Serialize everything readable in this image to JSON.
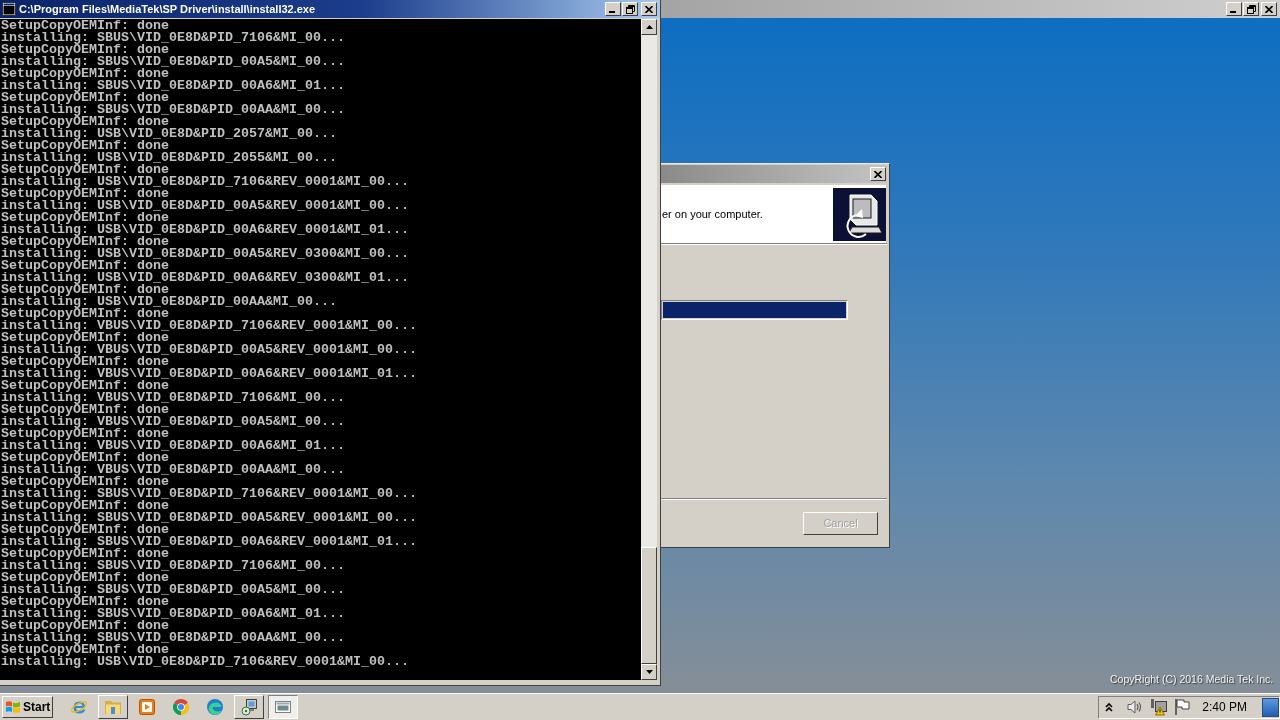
{
  "console_window": {
    "title": "C:\\Program Files\\MediaTek\\SP Driver\\install\\install32.exe",
    "lines": [
      "SetupCopyOEMInf: done",
      "installing: SBUS\\VID_0E8D&PID_7106&MI_00...",
      "SetupCopyOEMInf: done",
      "installing: SBUS\\VID_0E8D&PID_00A5&MI_00...",
      "SetupCopyOEMInf: done",
      "installing: SBUS\\VID_0E8D&PID_00A6&MI_01...",
      "SetupCopyOEMInf: done",
      "installing: SBUS\\VID_0E8D&PID_00AA&MI_00...",
      "SetupCopyOEMInf: done",
      "installing: USB\\VID_0E8D&PID_2057&MI_00...",
      "SetupCopyOEMInf: done",
      "installing: USB\\VID_0E8D&PID_2055&MI_00...",
      "SetupCopyOEMInf: done",
      "installing: USB\\VID_0E8D&PID_7106&REV_0001&MI_00...",
      "SetupCopyOEMInf: done",
      "installing: USB\\VID_0E8D&PID_00A5&REV_0001&MI_00...",
      "SetupCopyOEMInf: done",
      "installing: USB\\VID_0E8D&PID_00A6&REV_0001&MI_01...",
      "SetupCopyOEMInf: done",
      "installing: USB\\VID_0E8D&PID_00A5&REV_0300&MI_00...",
      "SetupCopyOEMInf: done",
      "installing: USB\\VID_0E8D&PID_00A6&REV_0300&MI_01...",
      "SetupCopyOEMInf: done",
      "installing: USB\\VID_0E8D&PID_00AA&MI_00...",
      "SetupCopyOEMInf: done",
      "installing: VBUS\\VID_0E8D&PID_7106&REV_0001&MI_00...",
      "SetupCopyOEMInf: done",
      "installing: VBUS\\VID_0E8D&PID_00A5&REV_0001&MI_00...",
      "SetupCopyOEMInf: done",
      "installing: VBUS\\VID_0E8D&PID_00A6&REV_0001&MI_01...",
      "SetupCopyOEMInf: done",
      "installing: VBUS\\VID_0E8D&PID_7106&MI_00...",
      "SetupCopyOEMInf: done",
      "installing: VBUS\\VID_0E8D&PID_00A5&MI_00...",
      "SetupCopyOEMInf: done",
      "installing: VBUS\\VID_0E8D&PID_00A6&MI_01...",
      "SetupCopyOEMInf: done",
      "installing: VBUS\\VID_0E8D&PID_00AA&MI_00...",
      "SetupCopyOEMInf: done",
      "installing: SBUS\\VID_0E8D&PID_7106&REV_0001&MI_00...",
      "SetupCopyOEMInf: done",
      "installing: SBUS\\VID_0E8D&PID_00A5&REV_0001&MI_00...",
      "SetupCopyOEMInf: done",
      "installing: SBUS\\VID_0E8D&PID_00A6&REV_0001&MI_01...",
      "SetupCopyOEMInf: done",
      "installing: SBUS\\VID_0E8D&PID_7106&MI_00...",
      "SetupCopyOEMInf: done",
      "installing: SBUS\\VID_0E8D&PID_00A5&MI_00...",
      "SetupCopyOEMInf: done",
      "installing: SBUS\\VID_0E8D&PID_00A6&MI_01...",
      "SetupCopyOEMInf: done",
      "installing: SBUS\\VID_0E8D&PID_00AA&MI_00...",
      "SetupCopyOEMInf: done",
      "installing: USB\\VID_0E8D&PID_7106&REV_0001&MI_00..."
    ]
  },
  "setup_dialog": {
    "header_text": "er on your computer.",
    "progress": {
      "level": 1
    },
    "cancel_button": {
      "label": "Cancel",
      "disabled": true
    }
  },
  "desktop": {
    "copyright": "CopyRight (C) 2016 Media Tek Inc."
  },
  "taskbar": {
    "start_label": "Start",
    "buttons": [
      {
        "kind": "pinned",
        "selected": false
      },
      {
        "kind": "window",
        "selected": false
      },
      {
        "kind": "pinned",
        "selected": false
      },
      {
        "kind": "pinned",
        "selected": false
      },
      {
        "kind": "pinned",
        "selected": false
      },
      {
        "kind": "window",
        "selected": false
      },
      {
        "kind": "window",
        "selected": true
      }
    ],
    "clock": "2:40 PM"
  }
}
